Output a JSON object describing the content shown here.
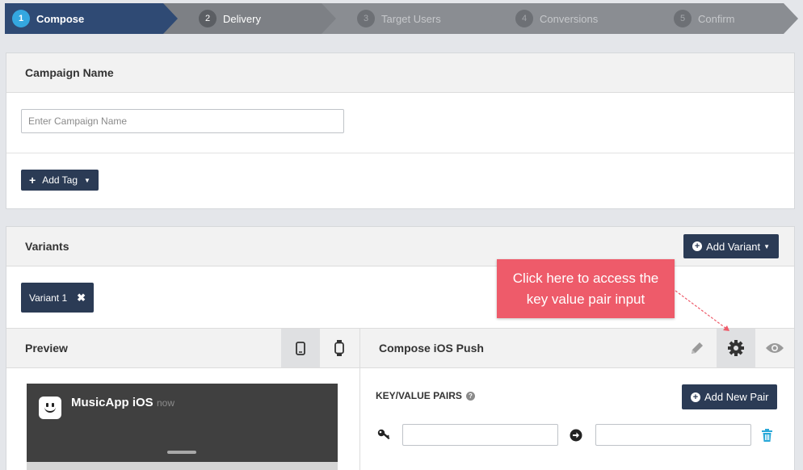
{
  "wizard": {
    "steps": [
      {
        "num": "1",
        "label": "Compose",
        "state": "active"
      },
      {
        "num": "2",
        "label": "Delivery",
        "state": "done"
      },
      {
        "num": "3",
        "label": "Target Users",
        "state": "pending"
      },
      {
        "num": "4",
        "label": "Conversions",
        "state": "pending"
      },
      {
        "num": "5",
        "label": "Confirm",
        "state": "pending"
      }
    ]
  },
  "campaign": {
    "title": "Campaign Name",
    "name_placeholder": "Enter Campaign Name",
    "add_tag_label": "Add Tag"
  },
  "variants": {
    "title": "Variants",
    "add_variant_label": "Add Variant",
    "variant_chip_label": "Variant 1"
  },
  "preview": {
    "title": "Preview",
    "app_name": "MusicApp iOS",
    "time": "now"
  },
  "compose": {
    "title": "Compose iOS Push",
    "kv_label": "KEY/VALUE PAIRS",
    "add_pair_label": "Add New Pair"
  },
  "callout": {
    "text": "Click here to access the key value pair input"
  },
  "colors": {
    "nav_active": "#2f4a74",
    "step_badge": "#34a7e0",
    "dark_button": "#2b3b55",
    "callout": "#ee5b6a",
    "trash": "#29a8d8"
  }
}
